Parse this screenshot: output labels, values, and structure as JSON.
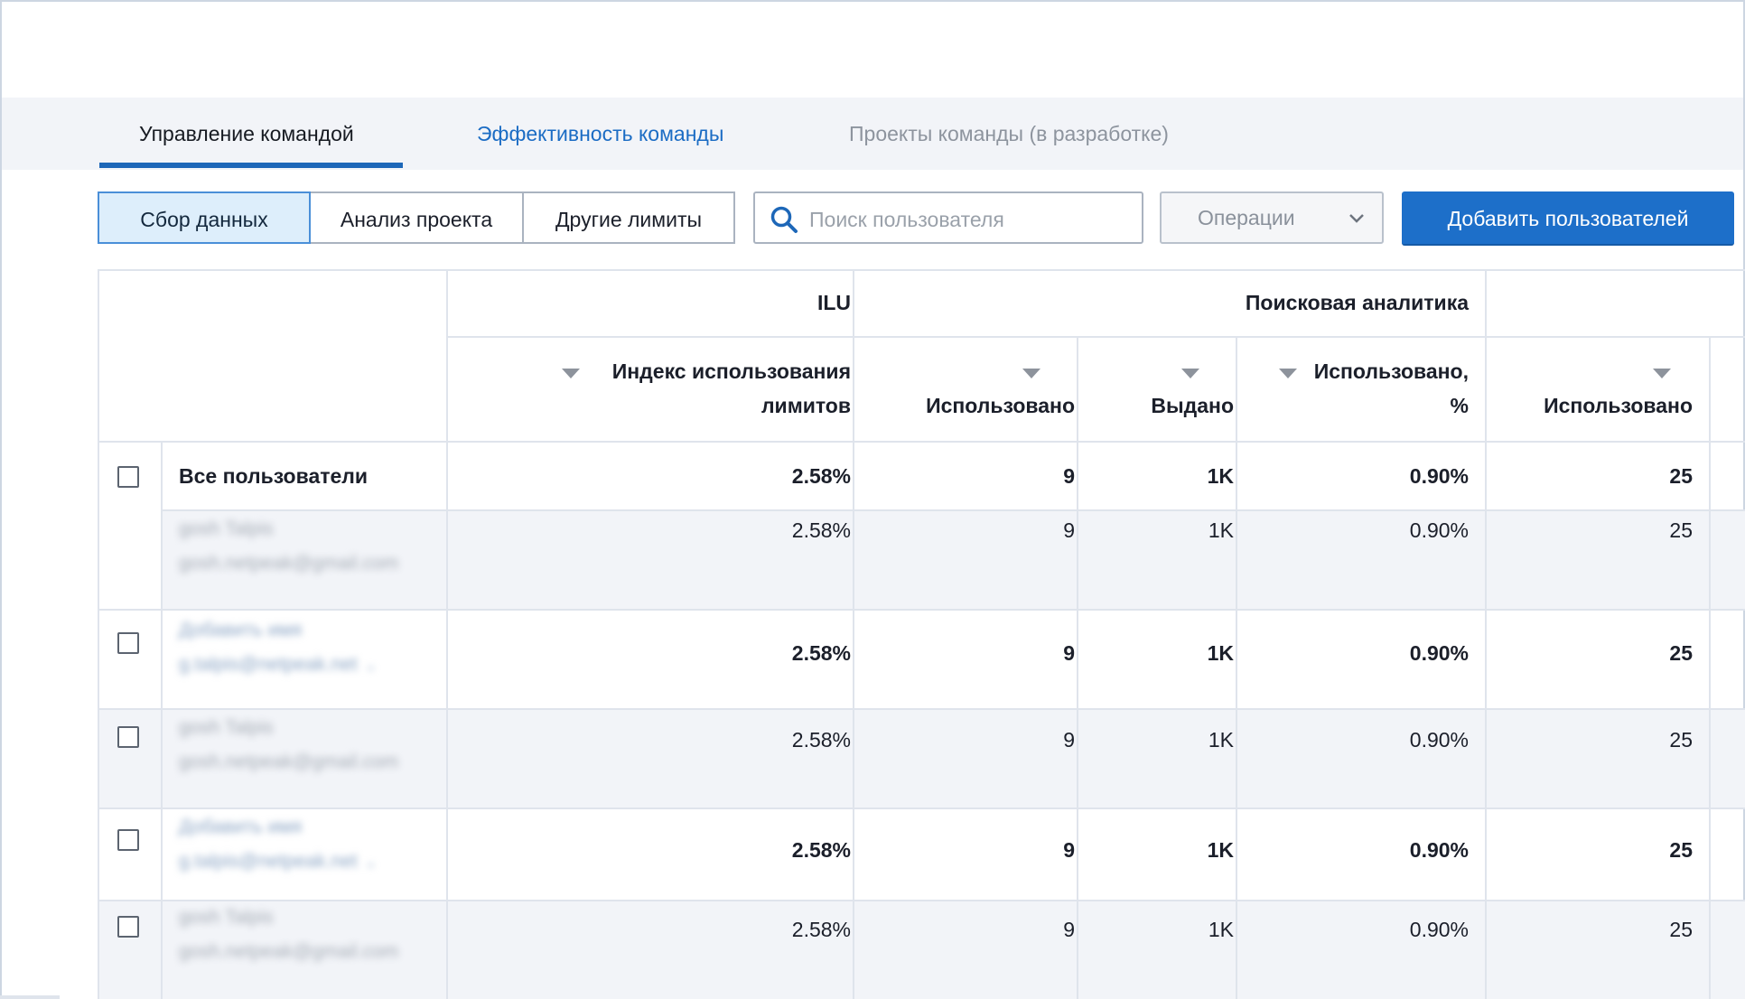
{
  "tabs": [
    {
      "label": "Управление командой",
      "active": true
    },
    {
      "label": "Эффективность команды",
      "active": false
    },
    {
      "label": "Проекты команды (в разработке)",
      "active": false
    }
  ],
  "segments": [
    "Сбор данных",
    "Анализ проекта",
    "Другие лимиты"
  ],
  "search": {
    "placeholder": "Поиск пользователя",
    "value": ""
  },
  "operations": {
    "label": "Операции"
  },
  "add_button": {
    "label": "Добавить пользователей"
  },
  "table": {
    "group_headers": {
      "ilu": "ILU",
      "search": "Поисковая аналитика"
    },
    "columns": {
      "ilu_line1": "Индекс использования",
      "ilu_line2": "лимитов",
      "used": "Использовано",
      "issued": "Выдано",
      "used_pct_line1": "Использовано,",
      "used_pct_line2": "%",
      "used2": "Использовано"
    },
    "all_users": {
      "label": "Все пользователи",
      "ilu": "2.58%",
      "used": "9",
      "issued": "1K",
      "pct": "0.90%",
      "used2": "25"
    },
    "rows": [
      {
        "name": "gosh Talpis",
        "email": "gosh.netpeak@gmail.com",
        "ilu": "2.58%",
        "used": "9",
        "issued": "1K",
        "pct": "0.90%",
        "used2": "25"
      },
      {
        "name": "Добавить имя",
        "email": "g.talpis@netpeak.net",
        "ilu": "2.58%",
        "used": "9",
        "issued": "1K",
        "pct": "0.90%",
        "used2": "25"
      },
      {
        "name": "gosh Talpis",
        "email": "gosh.netpeak@gmail.com",
        "ilu": "2.58%",
        "used": "9",
        "issued": "1K",
        "pct": "0.90%",
        "used2": "25"
      },
      {
        "name": "Добавить имя",
        "email": "g.talpis@netpeak.net",
        "ilu": "2.58%",
        "used": "9",
        "issued": "1K",
        "pct": "0.90%",
        "used2": "25"
      },
      {
        "name": "gosh Talpis",
        "email": "gosh.netpeak@gmail.com",
        "ilu": "2.58%",
        "used": "9",
        "issued": "1K",
        "pct": "0.90%",
        "used2": "25"
      }
    ]
  },
  "colors": {
    "accent": "#1d6fc9",
    "active_tab_text": "#1b6cc4",
    "row_shade": "#f2f4f8"
  }
}
